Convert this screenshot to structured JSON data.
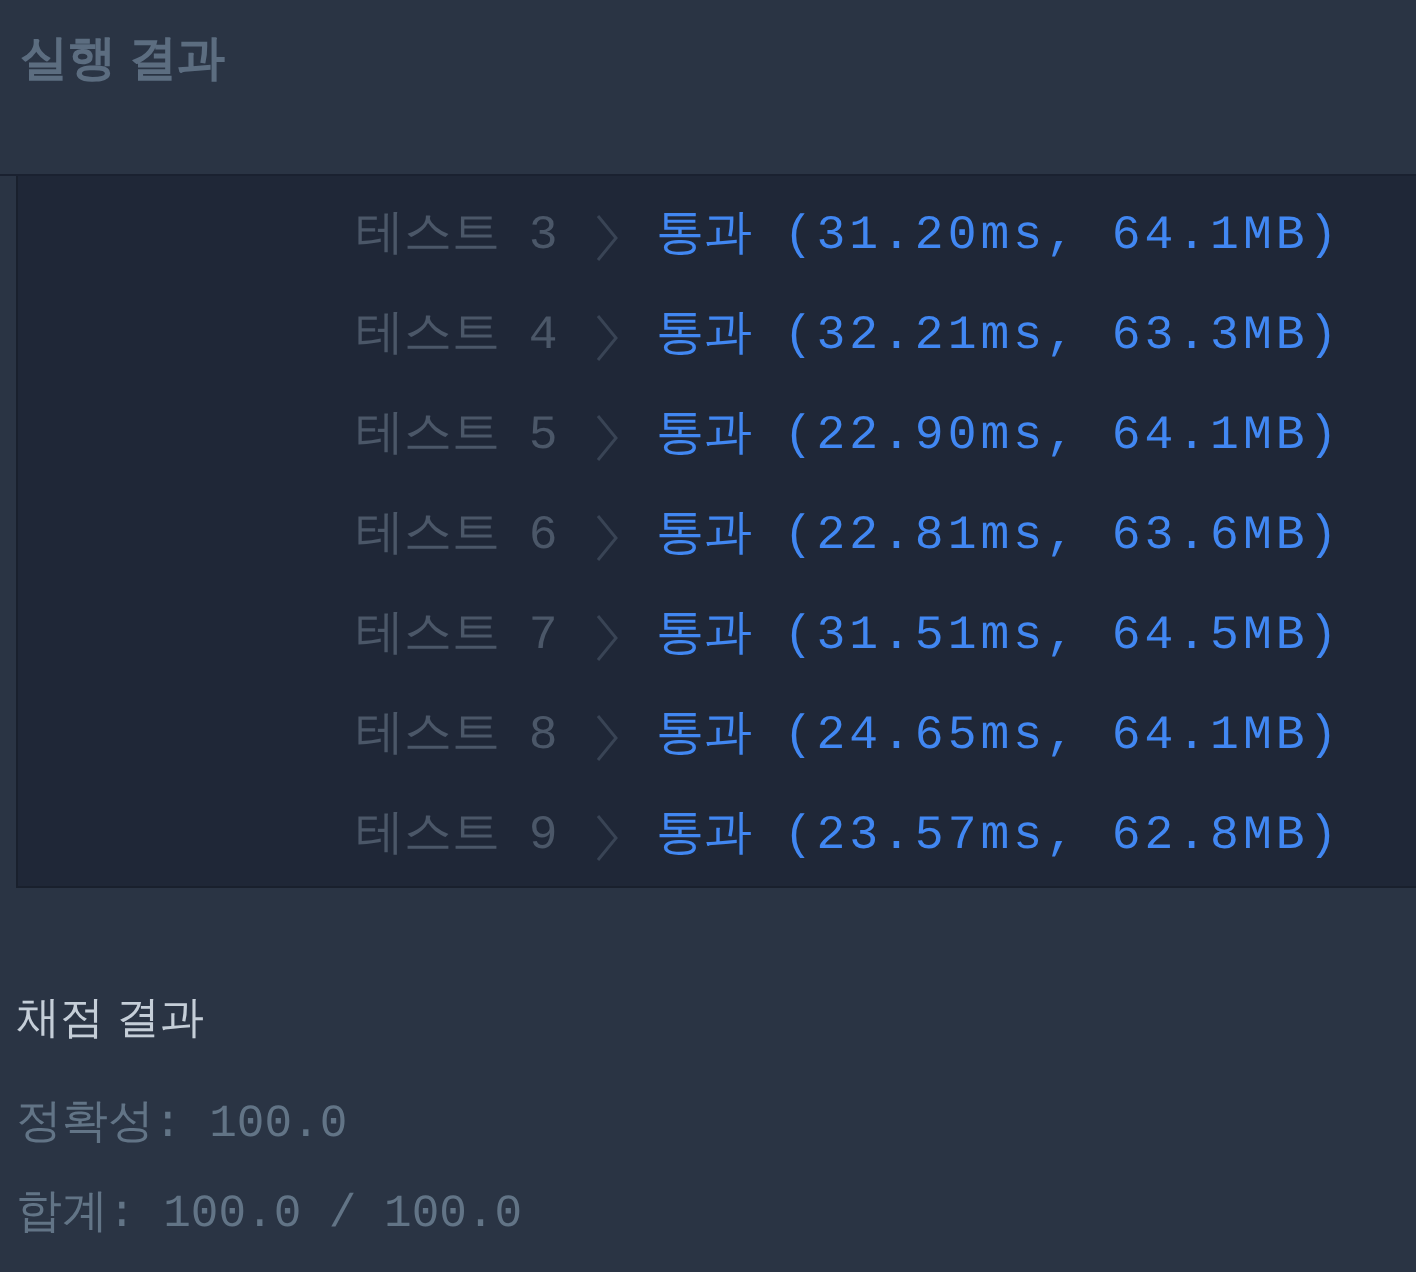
{
  "section_title": "실행 결과",
  "tests": [
    {
      "label": "테스트 3",
      "passed": true,
      "status": "통과",
      "detail": "(31.20ms, 64.1MB)"
    },
    {
      "label": "테스트 4",
      "passed": true,
      "status": "통과",
      "detail": "(32.21ms, 63.3MB)"
    },
    {
      "label": "테스트 5",
      "passed": true,
      "status": "통과",
      "detail": "(22.90ms, 64.1MB)"
    },
    {
      "label": "테스트 6",
      "passed": true,
      "status": "통과",
      "detail": "(22.81ms, 63.6MB)"
    },
    {
      "label": "테스트 7",
      "passed": true,
      "status": "통과",
      "detail": "(31.51ms, 64.5MB)"
    },
    {
      "label": "테스트 8",
      "passed": true,
      "status": "통과",
      "detail": "(24.65ms, 64.1MB)"
    },
    {
      "label": "테스트 9",
      "passed": true,
      "status": "통과",
      "detail": "(23.57ms, 62.8MB)"
    }
  ],
  "grading": {
    "title": "채점 결과",
    "lines": [
      "정확성: 100.0",
      "합계: 100.0 / 100.0"
    ]
  }
}
